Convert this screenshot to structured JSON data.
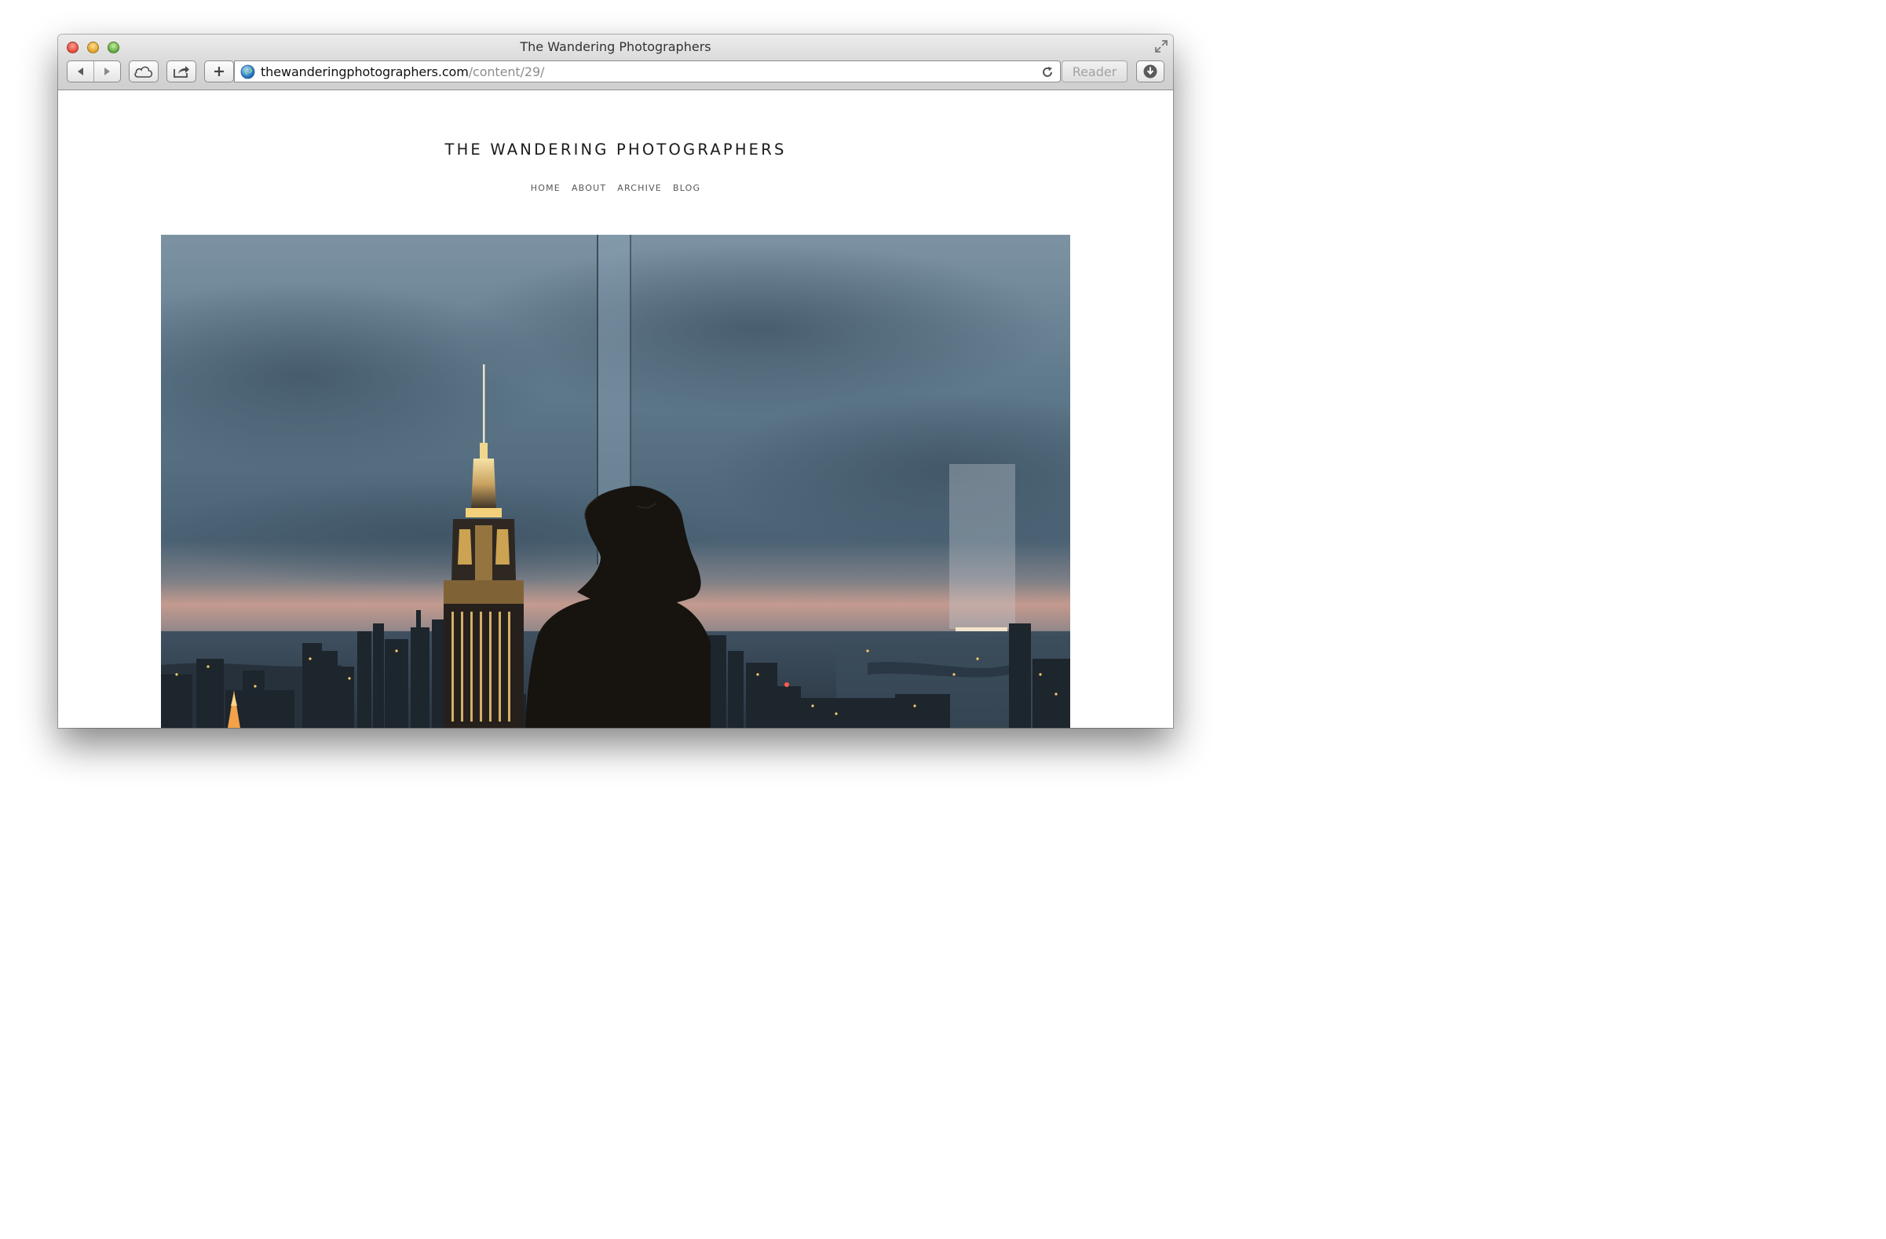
{
  "browser": {
    "window_title": "The Wandering Photographers",
    "url_host": "thewanderingphotographers.com",
    "url_path": "/content/29/",
    "reader_label": "Reader",
    "icons": {
      "close": "close-icon",
      "minimize": "minimize-icon",
      "zoom": "zoom-icon",
      "fullscreen": "fullscreen-icon",
      "back": "back-arrow-icon",
      "forward": "forward-arrow-icon",
      "cloud": "icloud-tabs-icon",
      "share": "share-icon",
      "add": "add-bookmark-icon",
      "site": "globe-icon",
      "reload": "reload-icon",
      "downloads": "downloads-icon"
    }
  },
  "site": {
    "title": "THE WANDERING PHOTOGRAPHERS",
    "nav": [
      {
        "label": "HOME"
      },
      {
        "label": "ABOUT"
      },
      {
        "label": "ARCHIVE"
      },
      {
        "label": "BLOG"
      }
    ]
  },
  "colors": {
    "sky": "#5f7a8c",
    "horizon": "#c49a8e",
    "city_lights": "#ffce6a"
  }
}
